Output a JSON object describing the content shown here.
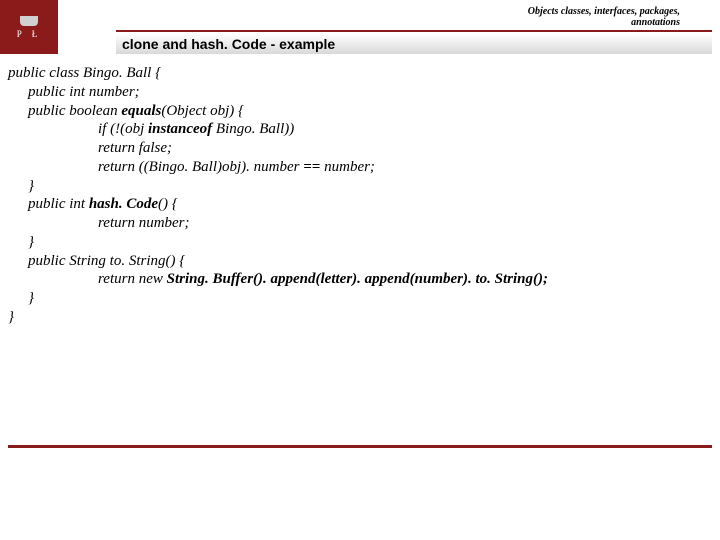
{
  "header": {
    "logo_letters": "P Ł",
    "breadcrumb_line1": "Objects classes, interfaces, packages,",
    "breadcrumb_line2": "annotations"
  },
  "title": "clone and hash. Code - example",
  "code": {
    "l1": "public class Bingo. Ball  {",
    "l2": "public int number;",
    "l3a": "public boolean ",
    "l3b": "equals",
    "l3c": "(Object obj) {",
    "l4a": "if (!(obj ",
    "l4b": "instanceof ",
    "l4c": "Bingo. Ball))",
    "l5": "return false;",
    "l6a": "return ((Bingo. Ball)obj). number ",
    "l6b": "== ",
    "l6c": "number;",
    "l7": "}",
    "l8a": "public int ",
    "l8b": "hash. Code",
    "l8c": "() {",
    "l9": "return number;",
    "l10": "}",
    "l11": "public String to. String() {",
    "l12a": "return new ",
    "l12b": "String. Buffer(). append(letter). append(number). to. String();",
    "l13": "}",
    "l14": "}"
  }
}
